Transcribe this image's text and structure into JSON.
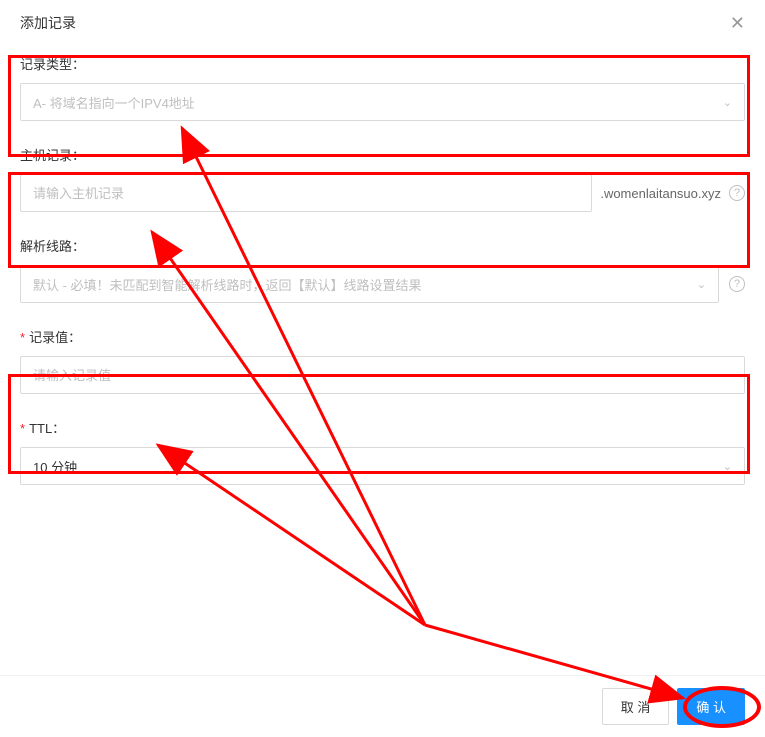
{
  "modal": {
    "title": "添加记录",
    "close_symbol": "✕"
  },
  "fields": {
    "record_type": {
      "label": "记录类型：",
      "value": "A- 将域名指向一个IPV4地址"
    },
    "hostname": {
      "label": "主机记录：",
      "placeholder": "请输入主机记录",
      "domain_suffix": ".womenlaitansuo.xyz"
    },
    "route": {
      "label": "解析线路：",
      "value": "默认 - 必填！未匹配到智能解析线路时，返回【默认】线路设置结果"
    },
    "record_value": {
      "label": "记录值：",
      "placeholder": "请输入记录值"
    },
    "ttl": {
      "label": "TTL：",
      "value": "10 分钟"
    }
  },
  "footer": {
    "cancel": "取 消",
    "confirm": "确 认"
  },
  "icons": {
    "help": "?"
  }
}
